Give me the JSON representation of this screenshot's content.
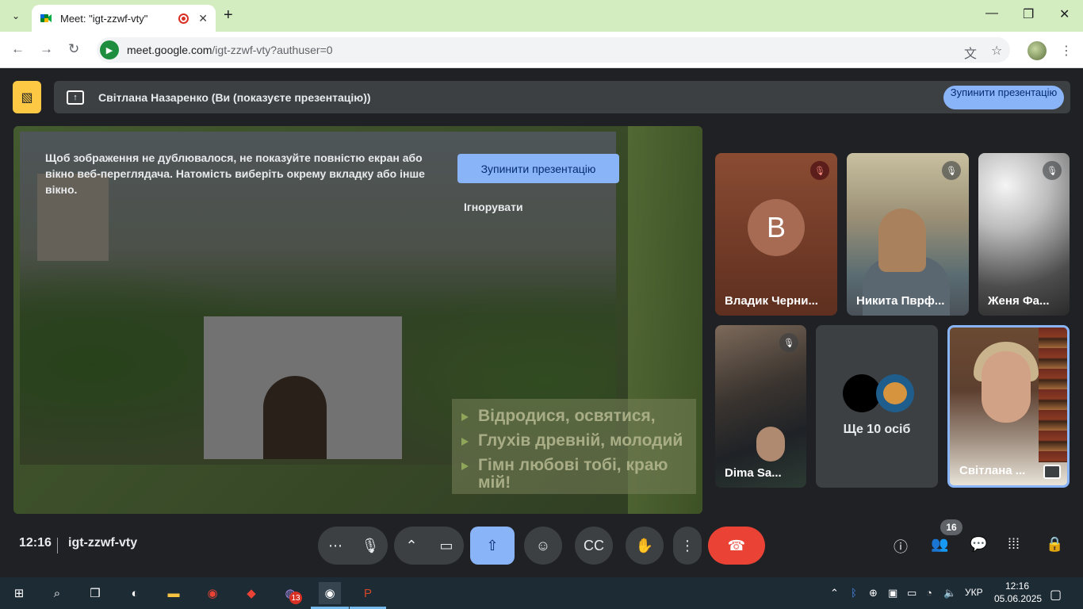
{
  "browser": {
    "tab_title": "Meet: \"igt-zzwf-vty\"",
    "url_host": "meet.google.com",
    "url_path": "/igt-zzwf-vty?authuser=0"
  },
  "banner": {
    "presenter_text": "Світлана Назаренко (Ви (показуєте презентацію))",
    "stop_button": "Зупинити презентацію"
  },
  "stage": {
    "warning": "Щоб зображення не дублювалося, не показуйте повністю екран або вікно веб-переглядача. Натомість виберіть окрему вкладку або інше вікно.",
    "stop_button": "Зупинити презентацію",
    "ignore": "Ігнорувати",
    "slide_lines": [
      "Відродися, освятися,",
      "Глухів древній, молодий",
      "Гімн любові тобі, краю мій!"
    ]
  },
  "participants": [
    {
      "name": "Владик Черни...",
      "initial": "В",
      "muted": true
    },
    {
      "name": "Никита Пврф...",
      "muted": true
    },
    {
      "name": "Женя Фа...",
      "muted": true
    },
    {
      "name": "Dima Sa...",
      "muted": true
    },
    {
      "name": "Ще 10 осіб"
    },
    {
      "name": "Світлана ..."
    }
  ],
  "controls": {
    "clock": "12:16",
    "meeting_code": "igt-zzwf-vty",
    "people_count": "16"
  },
  "taskbar": {
    "viber_badge": "13",
    "lang": "УКР",
    "time": "12:16",
    "date": "05.06.2025"
  }
}
